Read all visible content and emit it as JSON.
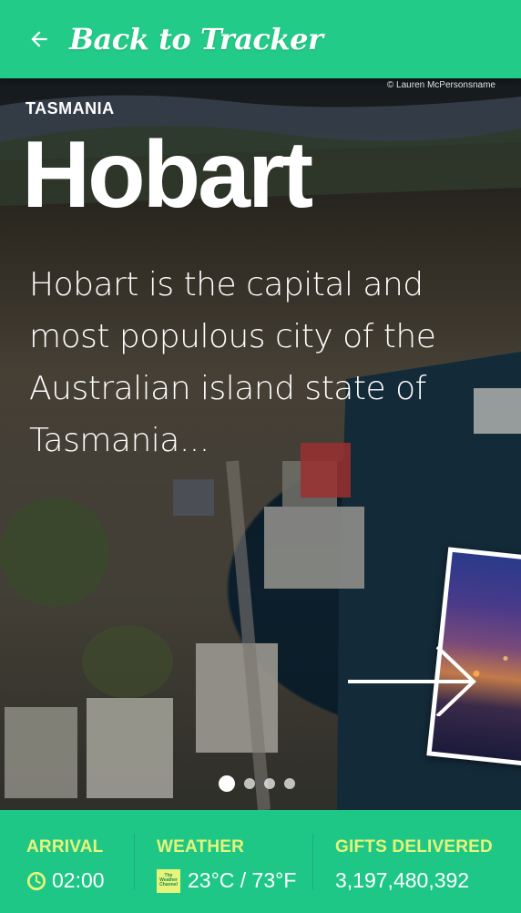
{
  "header": {
    "back_label": "Back to Tracker",
    "back_icon": "arrow-left-icon"
  },
  "hero": {
    "photo_credit": "© Lauren McPersonsname",
    "region": "TASMANIA",
    "city": "Hobart",
    "description": "Hobart is the capital and most populous city of the Australian island state of Tasmania...",
    "carousel": {
      "slide_count": 4,
      "active_index": 0
    },
    "next_icon": "arrow-right-icon"
  },
  "info": {
    "arrival": {
      "label": "ARRIVAL",
      "value": "02:00",
      "icon": "clock-icon"
    },
    "weather": {
      "label": "WEATHER",
      "value": "23°C / 73°F",
      "icon": "weather-channel-logo",
      "logo_text": "The Weather Channel"
    },
    "gifts": {
      "label": "GIFTS DELIVERED",
      "value": "3,197,480,392"
    }
  },
  "colors": {
    "brand_green": "#23cb88",
    "accent_yellow": "#e6f57a",
    "text_white": "#ffffff"
  }
}
